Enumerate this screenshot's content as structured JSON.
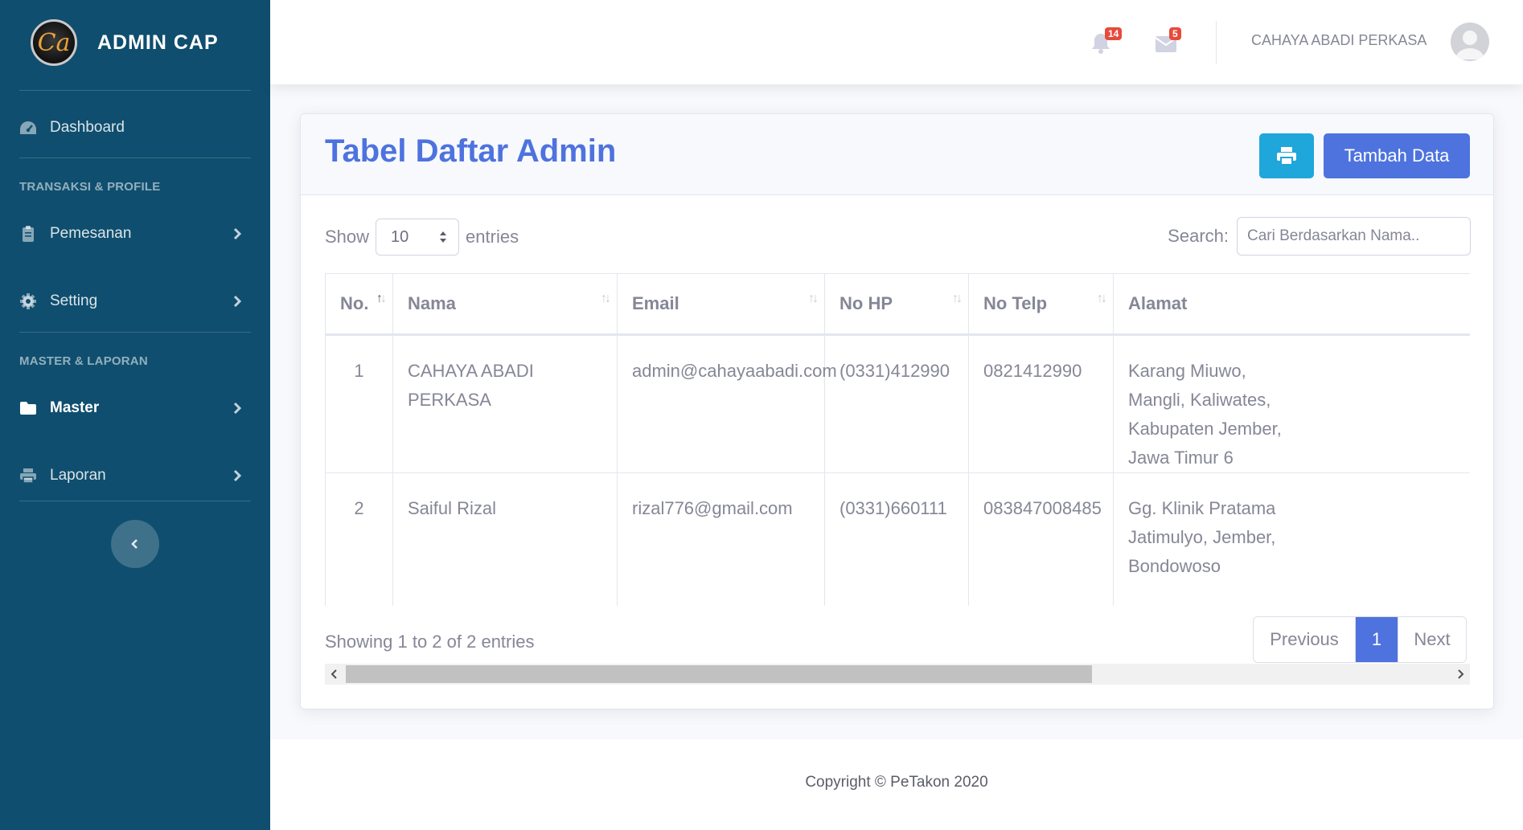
{
  "brand": {
    "title": "ADMIN CAP",
    "logo_text": "Ca"
  },
  "sidebar": {
    "dashboard": "Dashboard",
    "heading_1": "TRANSAKSI & PROFILE",
    "pemesanan": "Pemesanan",
    "setting": "Setting",
    "heading_2": "MASTER & LAPORAN",
    "master": "Master",
    "laporan": "Laporan"
  },
  "topbar": {
    "alerts_count": "14",
    "messages_count": "5",
    "username": "CAHAYA ABADI PERKASA"
  },
  "card": {
    "title": "Tabel Daftar Admin",
    "add_button": "Tambah Data",
    "show_label": "Show",
    "entries_value": "10",
    "entries_label": "entries",
    "search_label": "Search:",
    "search_placeholder": "Cari Berdasarkan Nama..",
    "info": "Showing 1 to 2 of 2 entries",
    "pager": {
      "previous": "Previous",
      "current": "1",
      "next": "Next"
    }
  },
  "table": {
    "columns": [
      "No.",
      "Nama",
      "Email",
      "No HP",
      "No Telp",
      "Alamat"
    ],
    "rows": [
      {
        "no": "1",
        "nama": "CAHAYA ABADI PERKASA",
        "email": "admin@cahayaabadi.com",
        "hp": "(0331)412990",
        "telp": "0821412990",
        "alamat": "Karang Miuwo, Mangli, Kaliwates, Kabupaten Jember, Jawa Timur 6"
      },
      {
        "no": "2",
        "nama": "Saiful Rizal",
        "email": "rizal776@gmail.com",
        "hp": "(0331)660111",
        "telp": "083847008485",
        "alamat": "Gg. Klinik Pratama Jatimulyo, Jember, Bondowoso"
      }
    ]
  },
  "footer": {
    "copyright": "Copyright © PeTakon 2020"
  },
  "colors": {
    "sidebar": "#0f4e6e",
    "primary": "#4e73df",
    "info": "#1fa6da",
    "danger": "#e74a3b"
  }
}
